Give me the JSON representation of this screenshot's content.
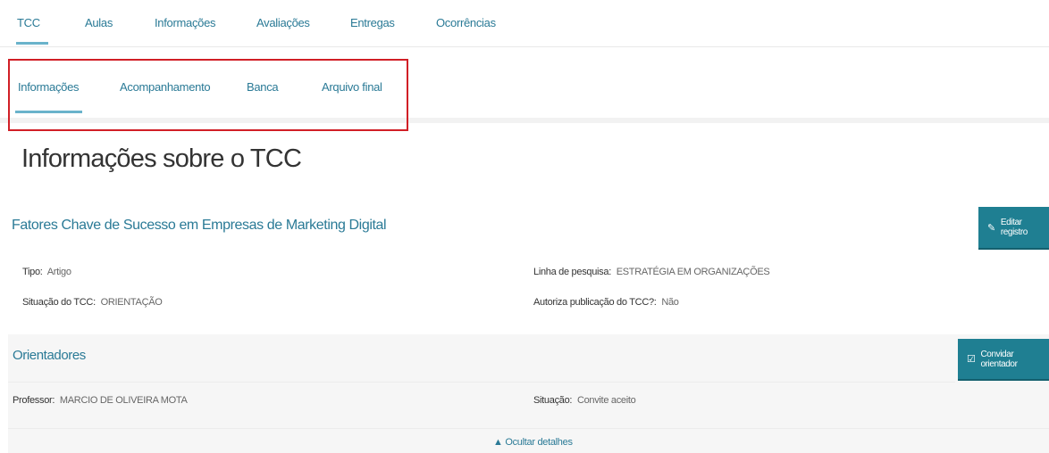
{
  "top_tabs": [
    "TCC",
    "Aulas",
    "Informações",
    "Avaliações",
    "Entregas",
    "Ocorrências"
  ],
  "sub_tabs": [
    "Informações",
    "Acompanhamento",
    "Banca",
    "Arquivo final"
  ],
  "page_title": "Informações sobre o TCC",
  "tcc_title": "Fatores Chave de Sucesso em Empresas de Marketing Digital",
  "edit_button": {
    "icon": "edit-icon",
    "label": "Editar registro"
  },
  "details": {
    "tipo_label": "Tipo:",
    "tipo_value": "Artigo",
    "situacao_label": "Situação do TCC:",
    "situacao_value": "ORIENTAÇÃO",
    "linha_label": "Linha de pesquisa:",
    "linha_value": "ESTRATÉGIA EM ORGANIZAÇÕES",
    "autoriza_label": "Autoriza publicação do TCC?:",
    "autoriza_value": "Não"
  },
  "orientadores": {
    "title": "Orientadores",
    "button_label": "Convidar orientador",
    "professor_label": "Professor:",
    "professor_value": "MARCIO DE OLIVEIRA MOTA",
    "situacao_label": "Situação:",
    "situacao_value": "Convite aceito",
    "hide_details": "▲ Ocultar detalhes"
  },
  "colors": {
    "accent": "#2a7a96",
    "button": "#1f7f92",
    "highlight_box": "#d11f26"
  }
}
